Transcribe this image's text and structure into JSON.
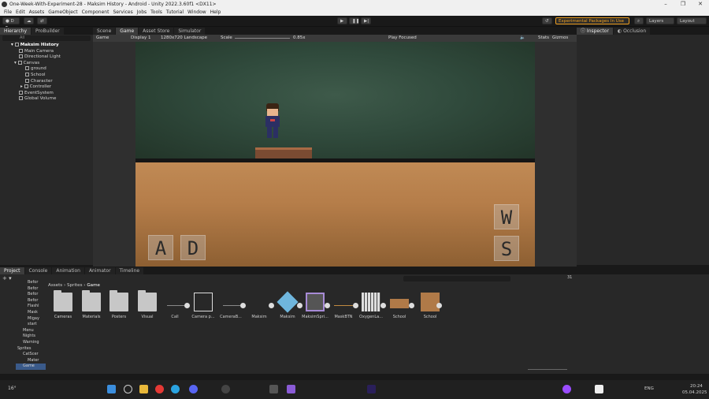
{
  "window": {
    "title": "One-Week-With-Experiment-28 - Maksim History - Android - Unity 2022.3.60f1 <DX11>"
  },
  "menu": [
    "File",
    "Edit",
    "Assets",
    "GameObject",
    "Component",
    "Services",
    "Jobs",
    "Tools",
    "Tutorial",
    "Window",
    "Help"
  ],
  "toolbar": {
    "experimental": "Experimental Packages In Use",
    "layers": "Layers",
    "layout": "Layout"
  },
  "hierarchy": {
    "tabs": [
      "Hierarchy",
      "ProBuilder"
    ],
    "search_placeholder": "All",
    "items": [
      "Maksim History",
      "Main Camera",
      "Directional Light",
      "Canvas",
      "ground",
      "School",
      "Character",
      "Controller",
      "EventSystem",
      "Global Volume"
    ]
  },
  "center": {
    "tabs": [
      "Scene",
      "Game",
      "Asset Store",
      "Simulator"
    ],
    "gamebar": {
      "mode": "Game",
      "display": "Display 1",
      "resolution": "1280x720 Landscape",
      "scale_label": "Scale",
      "scale_value": "0.85x",
      "play": "Play Focused",
      "stats": "Stats",
      "gizmos": "Gizmos"
    },
    "controls": {
      "left": "A",
      "right": "D",
      "up": "W",
      "down": "S"
    }
  },
  "inspector": {
    "tabs": [
      "Inspector",
      "Occlusion"
    ]
  },
  "bottom": {
    "tabs": [
      "Project",
      "Console",
      "Animation",
      "Animator",
      "Timeline"
    ],
    "breadcrumb": [
      "Assets",
      "Sprites",
      "Game"
    ],
    "badge": "31",
    "tree": [
      "Befor",
      "Befor",
      "Befor",
      "Befor",
      "Flashl",
      "Mask",
      "Migay",
      "start",
      "Menu",
      "Nights",
      "Warning",
      "Sprites",
      "CatScer",
      "Mater",
      "Game"
    ],
    "assets": [
      "Cameras",
      "Materials",
      "Posters",
      "Visual",
      "Call",
      "Camera p...",
      "CameraB...",
      "Maksim",
      "Maksim",
      "MaksimSpri...",
      "MaskBTN",
      "OxygenLa...",
      "School",
      "School"
    ]
  },
  "taskbar": {
    "lang": "ENG",
    "time": "20:24",
    "date": "05.04.2025",
    "temp": "16°"
  },
  "colors": {
    "accent": "#f0a020",
    "panel": "#282828",
    "header": "#191919"
  }
}
